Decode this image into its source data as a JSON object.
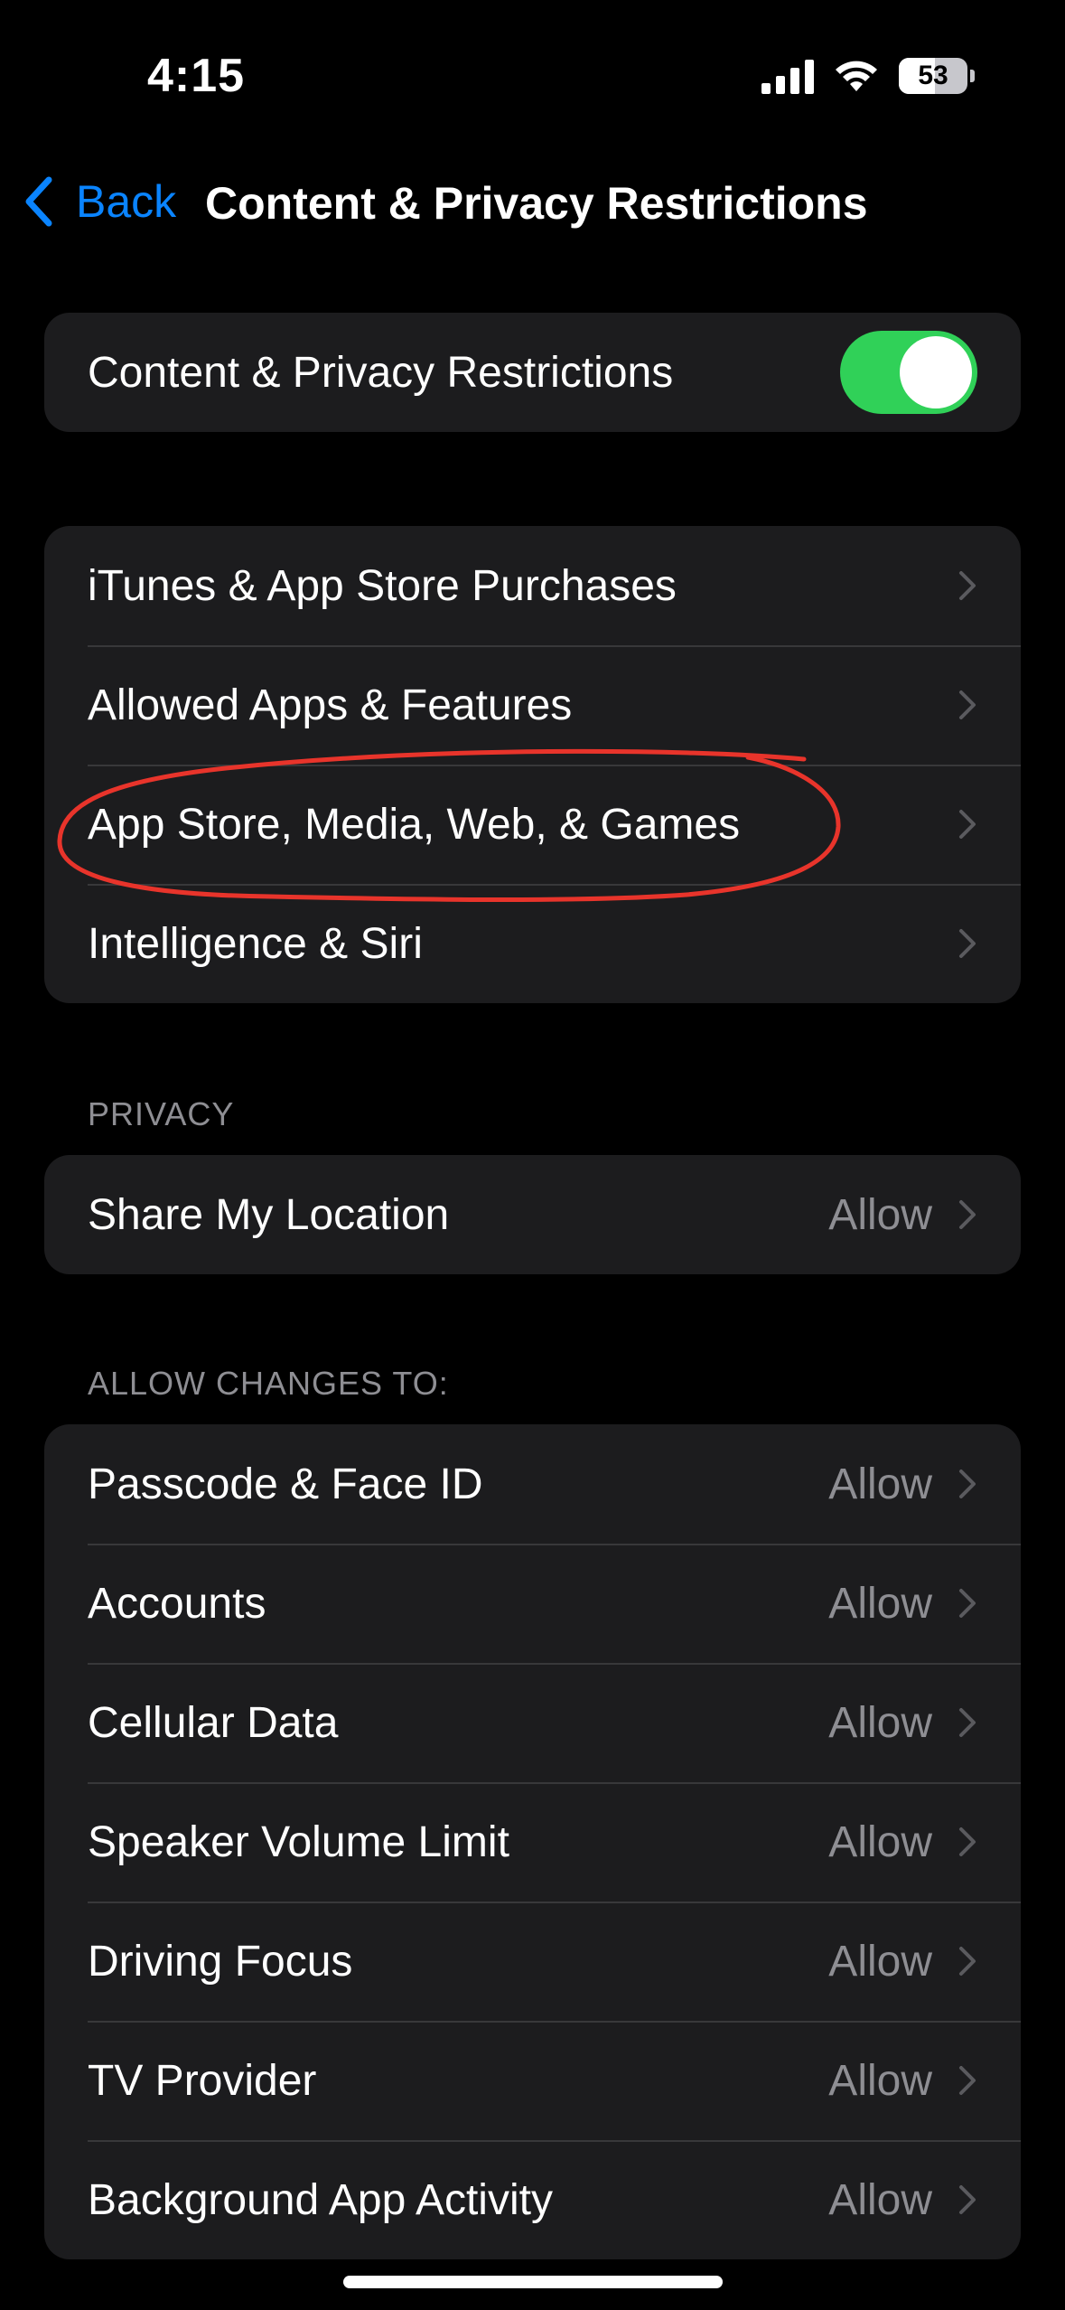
{
  "status_bar": {
    "time": "4:15",
    "battery_level": 53,
    "battery_text": "53",
    "icons": [
      "signal-icon",
      "wifi-icon",
      "battery-icon"
    ]
  },
  "nav": {
    "back_label": "Back",
    "title": "Content & Privacy Restrictions"
  },
  "master_toggle": {
    "label": "Content & Privacy Restrictions",
    "enabled": true
  },
  "content_group": {
    "items": [
      {
        "label": "iTunes & App Store Purchases"
      },
      {
        "label": "Allowed Apps & Features"
      },
      {
        "label": "App Store, Media, Web, & Games"
      },
      {
        "label": "Intelligence & Siri"
      }
    ]
  },
  "privacy_section": {
    "header": "PRIVACY",
    "items": [
      {
        "label": "Share My Location",
        "value": "Allow"
      }
    ]
  },
  "changes_section": {
    "header": "ALLOW CHANGES TO:",
    "items": [
      {
        "label": "Passcode & Face ID",
        "value": "Allow"
      },
      {
        "label": "Accounts",
        "value": "Allow"
      },
      {
        "label": "Cellular Data",
        "value": "Allow"
      },
      {
        "label": "Speaker Volume Limit",
        "value": "Allow"
      },
      {
        "label": "Driving Focus",
        "value": "Allow"
      },
      {
        "label": "TV Provider",
        "value": "Allow"
      },
      {
        "label": "Background App Activity",
        "value": "Allow"
      }
    ]
  },
  "colors": {
    "accent": "#0a84ff",
    "toggle_on": "#30d158",
    "annotation": "#e8342b",
    "cell_bg": "#1c1c1e",
    "secondary_text": "#8e8e93"
  }
}
